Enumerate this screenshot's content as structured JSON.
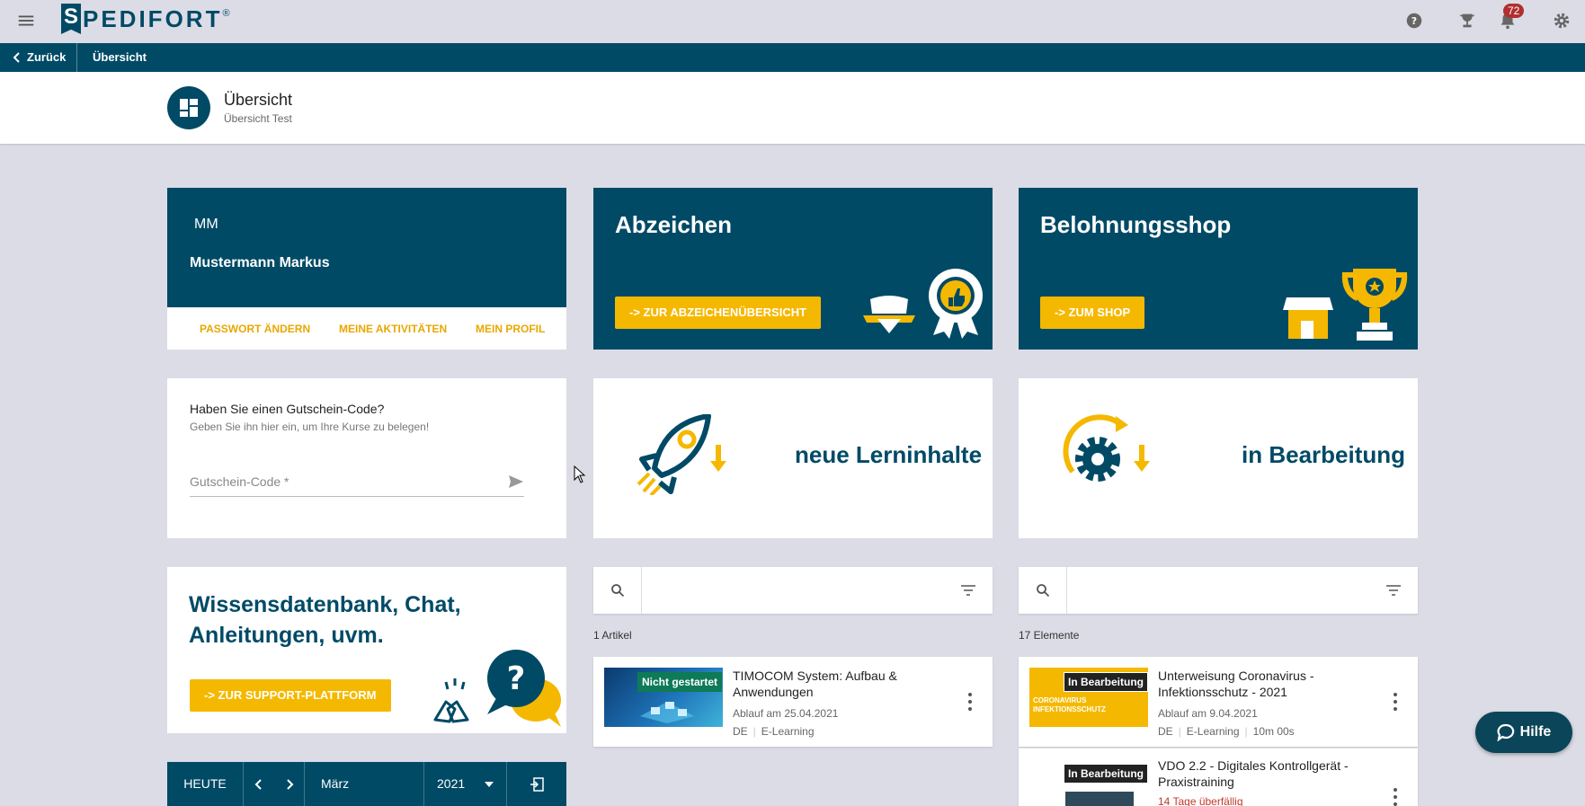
{
  "app": {
    "logo_letter": "S",
    "logo_text": "PEDIFORT",
    "logo_reg": "®"
  },
  "topbar": {
    "notification_count": "72"
  },
  "navbar": {
    "back_label": "Zurück",
    "crumb": "Übersicht"
  },
  "header": {
    "title": "Übersicht",
    "subtitle": "Übersicht Test"
  },
  "profile": {
    "initials": "MM",
    "name": "Mustermann Markus",
    "links": [
      "PASSWORT ÄNDERN",
      "MEINE AKTIVITÄTEN",
      "MEIN PROFIL"
    ]
  },
  "badges_card": {
    "title": "Abzeichen",
    "button": "-> ZUR ABZEICHENÜBERSICHT"
  },
  "shop_card": {
    "title": "Belohnungsshop",
    "button": "-> ZUM SHOP"
  },
  "voucher": {
    "title": "Haben Sie einen Gutschein-Code?",
    "subtitle": "Geben Sie ihn hier ein, um Ihre Kurse zu belegen!",
    "placeholder": "Gutschein-Code  *"
  },
  "new_content": {
    "label": "neue Lerninhalte"
  },
  "in_progress": {
    "label": "in Bearbeitung"
  },
  "support": {
    "title_line1": "Wissensdatenbank, Chat,",
    "title_line2": "Anleitungen, uvm.",
    "button": "-> ZUR SUPPORT-PLATTFORM"
  },
  "calendar": {
    "today": "HEUTE",
    "month": "März",
    "year": "2021"
  },
  "new_list": {
    "count": "1 Artikel",
    "items": [
      {
        "badge": "Nicht gestartet",
        "title_line1": "TIMOCOM System: Aufbau &",
        "title_line2": "Anwendungen",
        "expiry": "Ablauf am 25.04.2021",
        "lang": "DE",
        "type": "E-Learning"
      }
    ]
  },
  "progress_list": {
    "count": "17 Elemente",
    "items": [
      {
        "badge": "In Bearbeitung",
        "thumb_text_1": "CORONAVIRUS",
        "thumb_text_2": "INFEKTIONSSCHUTZ",
        "title_line1": "Unterweisung Coronavirus -",
        "title_line2": "Infektionsschutz - 2021",
        "expiry": "Ablauf am 9.04.2021",
        "lang": "DE",
        "type": "E-Learning",
        "duration": "10m 00s"
      },
      {
        "badge": "In Bearbeitung",
        "title_line1": "VDO 2.2 - Digitales Kontrollgerät -",
        "title_line2": "Praxistraining",
        "overdue": "14 Tage überfällig"
      }
    ]
  },
  "help_button": {
    "label": "Hilfe"
  },
  "colors": {
    "primary": "#004a66",
    "accent": "#f5b800",
    "background": "#dcdce6",
    "badge_red": "#b02f2f"
  }
}
